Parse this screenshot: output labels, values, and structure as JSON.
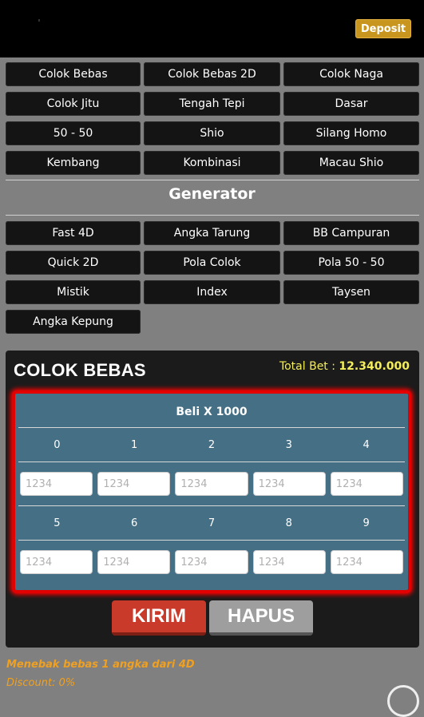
{
  "header": {
    "deposit_label": "Deposit"
  },
  "menu": {
    "items": [
      "Colok Bebas",
      "Colok Bebas 2D",
      "Colok Naga",
      "Colok Jitu",
      "Tengah Tepi",
      "Dasar",
      "50 - 50",
      "Shio",
      "Silang Homo",
      "Kembang",
      "Kombinasi",
      "Macau Shio"
    ]
  },
  "generator": {
    "title": "Generator",
    "items": [
      "Fast 4D",
      "Angka Tarung",
      "BB Campuran",
      "Quick 2D",
      "Pola Colok",
      "Pola 50 - 50",
      "Mistik",
      "Index",
      "Taysen",
      "Angka Kepung"
    ]
  },
  "panel": {
    "title": "COLOK BEBAS",
    "total_bet_label": "Total Bet :",
    "total_bet_value": "12.340.000",
    "table_header": "Beli X 1000",
    "numbers_row1": [
      "0",
      "1",
      "2",
      "3",
      "4"
    ],
    "numbers_row2": [
      "5",
      "6",
      "7",
      "8",
      "9"
    ],
    "input_placeholder": "1234",
    "submit_label": "KIRIM",
    "clear_label": "HAPUS"
  },
  "footer": {
    "description": "Menebak bebas 1 angka dari 4D",
    "discount": "Discount: 0%"
  },
  "colors": {
    "accent_gold": "#c8961f",
    "panel_blue": "#456f85",
    "highlight_red": "#e20000",
    "submit_red": "#c93a2b",
    "total_yellow": "#f4ee5c",
    "note_orange": "#f0a020"
  }
}
